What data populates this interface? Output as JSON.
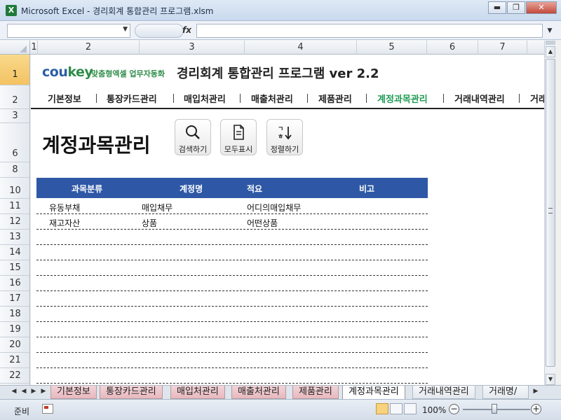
{
  "window": {
    "title": "Microsoft Excel - 경리회계 통합관리 프로그램.xlsm",
    "app_icon": "X",
    "min": "▭",
    "restore": "▭",
    "close": "✕"
  },
  "formula_bar": {
    "name_box": "",
    "fx": "fx",
    "formula": ""
  },
  "columns": [
    "1",
    "2",
    "3",
    "4",
    "5",
    "6",
    "7"
  ],
  "rows": [
    "1",
    "2",
    "3",
    "6",
    "8",
    "10",
    "11",
    "12",
    "13",
    "14",
    "15",
    "16",
    "17",
    "18",
    "19",
    "20",
    "21",
    "22"
  ],
  "brand": {
    "logo_cou": "cou",
    "logo_key": "key",
    "tagline": "맞춤형엑셀 업무자동화",
    "title": "경리회계 통합관리 프로그램 ver 2.2"
  },
  "nav": {
    "items": [
      "기본정보",
      "통장카드관리",
      "매입처관리",
      "매출처관리",
      "제품관리",
      "계정과목관리",
      "거래내역관리",
      "거래"
    ],
    "active_index": 5
  },
  "page": {
    "title": "계정과목관리"
  },
  "toolbar": {
    "search_label": "검색하기",
    "show_all_label": "모두표시",
    "sort_label": "정렬하기"
  },
  "table": {
    "headers": [
      "과목분류",
      "계정명",
      "적요",
      "비고"
    ],
    "rows": [
      [
        "유동부채",
        "매입채무",
        "어디의매입채무",
        ""
      ],
      [
        "재고자산",
        "상품",
        "어떤상품",
        ""
      ]
    ]
  },
  "sheet_tabs": {
    "items": [
      "기본정보",
      "통장카드관리",
      "매입처관리",
      "매출처관리",
      "제품관리",
      "계정과목관리",
      "거래내역관리",
      "거래명/"
    ],
    "active_index": 5
  },
  "status": {
    "ready": "준비",
    "zoom": "100%",
    "zoom_minus": "−",
    "zoom_plus": "+"
  },
  "colors": {
    "accent_green": "#1f9b54",
    "table_header": "#2e58a6",
    "brand_blue": "#2b5fa6"
  }
}
